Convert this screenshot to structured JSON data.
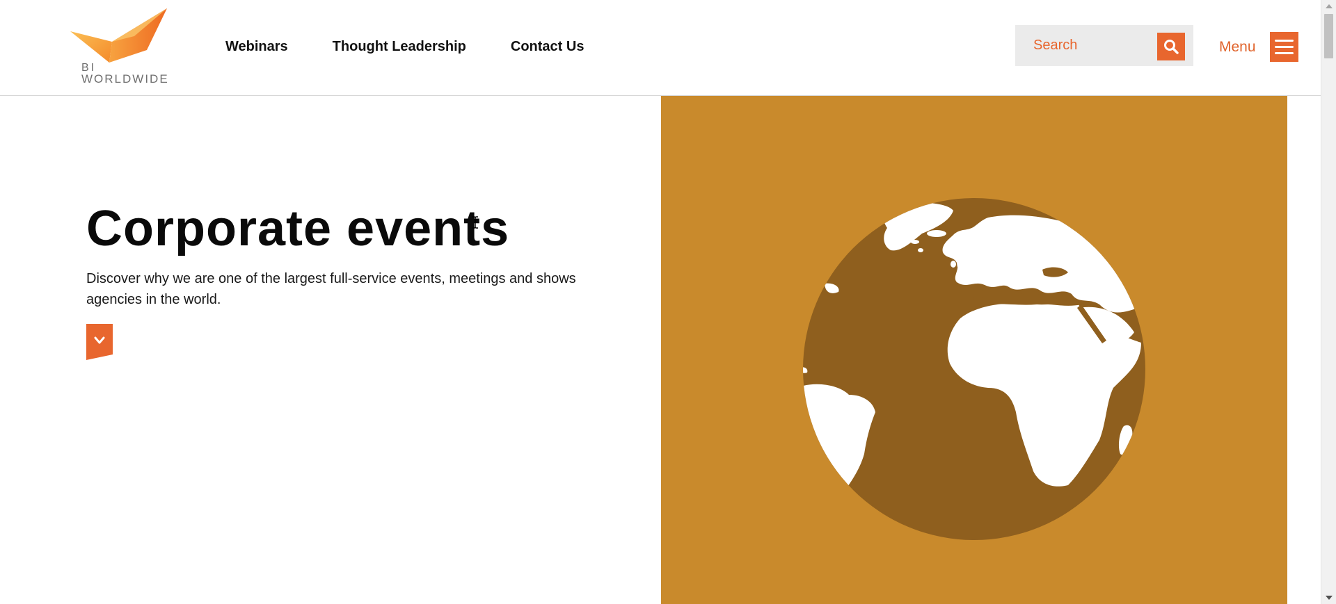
{
  "brand": {
    "line1": "BI",
    "line2": "WORLDWIDE"
  },
  "nav": {
    "items": [
      {
        "label": "Webinars"
      },
      {
        "label": "Thought Leadership"
      },
      {
        "label": "Contact Us"
      }
    ]
  },
  "search": {
    "placeholder": "Search",
    "icon": "search-icon"
  },
  "menu": {
    "label": "Menu",
    "icon": "hamburger-icon"
  },
  "hero": {
    "title": "Corporate events",
    "description": "Discover why we are one of the largest full-service events, meetings and shows agencies in the world.",
    "cta_icon": "chevron-down-icon",
    "image_icon": "globe-icon"
  },
  "colors": {
    "accent": "#e8662e",
    "hero_bg": "#c98a2c",
    "globe_ocean": "#8f5f1e",
    "land": "#ffffff"
  }
}
